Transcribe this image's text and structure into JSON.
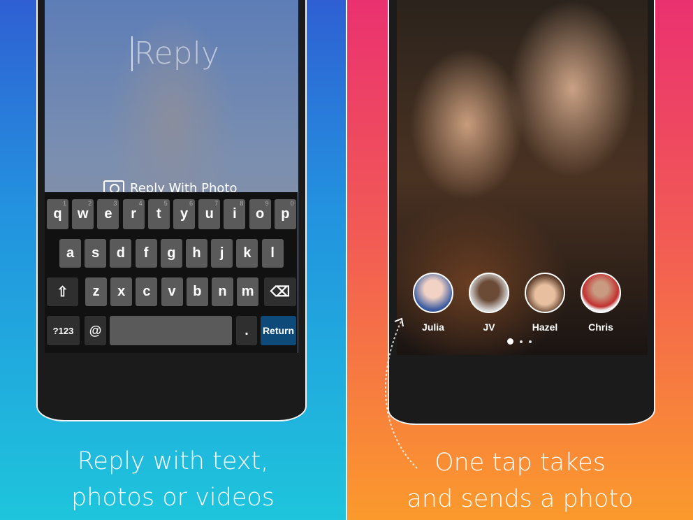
{
  "left": {
    "reply_placeholder": "Reply",
    "reply_with_photo": "Reply With Photo",
    "keyboard": {
      "row1": [
        {
          "k": "q",
          "n": "1"
        },
        {
          "k": "w",
          "n": "2"
        },
        {
          "k": "e",
          "n": "3"
        },
        {
          "k": "r",
          "n": "4"
        },
        {
          "k": "t",
          "n": "5"
        },
        {
          "k": "y",
          "n": "6"
        },
        {
          "k": "u",
          "n": "7"
        },
        {
          "k": "i",
          "n": "8"
        },
        {
          "k": "o",
          "n": "9"
        },
        {
          "k": "p",
          "n": "0"
        }
      ],
      "row2": [
        "a",
        "s",
        "d",
        "f",
        "g",
        "h",
        "j",
        "k",
        "l"
      ],
      "row3": [
        "z",
        "x",
        "c",
        "v",
        "b",
        "n",
        "m"
      ],
      "shift": "⇧",
      "backspace": "⌫",
      "symbols": "?123",
      "at": "@",
      "period": ".",
      "return": "Return"
    },
    "caption_line1": "Reply with text,",
    "caption_line2": "photos or videos"
  },
  "right": {
    "contacts": [
      {
        "name": "Julia"
      },
      {
        "name": "JV"
      },
      {
        "name": "Hazel"
      },
      {
        "name": "Chris"
      }
    ],
    "page_indicator": {
      "pages": 3,
      "current": 1
    },
    "caption_line1": "One tap takes",
    "caption_line2": "and sends a photo"
  },
  "colors": {
    "left_top": "#2f5fd3",
    "left_bottom": "#1ec5dc",
    "right_top": "#ea3170",
    "right_bottom": "#fb9a2c",
    "return_key": "#0d4a7a"
  }
}
